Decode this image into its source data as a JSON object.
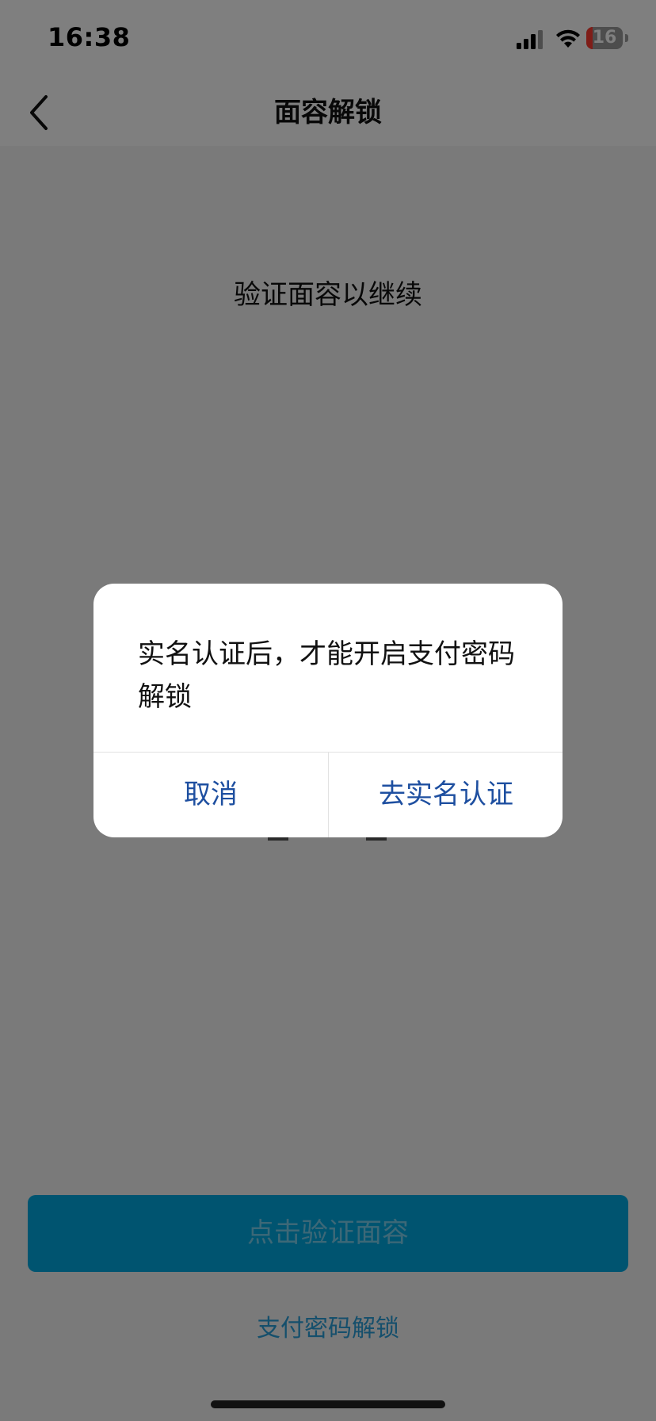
{
  "status_bar": {
    "time": "16:38",
    "battery_level": "16",
    "icons": [
      "signal-icon",
      "wifi-icon",
      "battery-icon"
    ]
  },
  "nav": {
    "title": "面容解锁",
    "back_icon": "chevron-left-icon"
  },
  "main": {
    "prompt": "验证面容以继续",
    "verify_button_label": "点击验证面容",
    "password_link_label": "支付密码解锁"
  },
  "dialog": {
    "message": "实名认证后，才能开启支付密码解锁",
    "cancel_label": "取消",
    "confirm_label": "去实名认证"
  },
  "colors": {
    "accent": "#00a8e0",
    "dialog_button_text": "#1e4fa0",
    "overlay": "rgba(0,0,0,0.50)"
  }
}
